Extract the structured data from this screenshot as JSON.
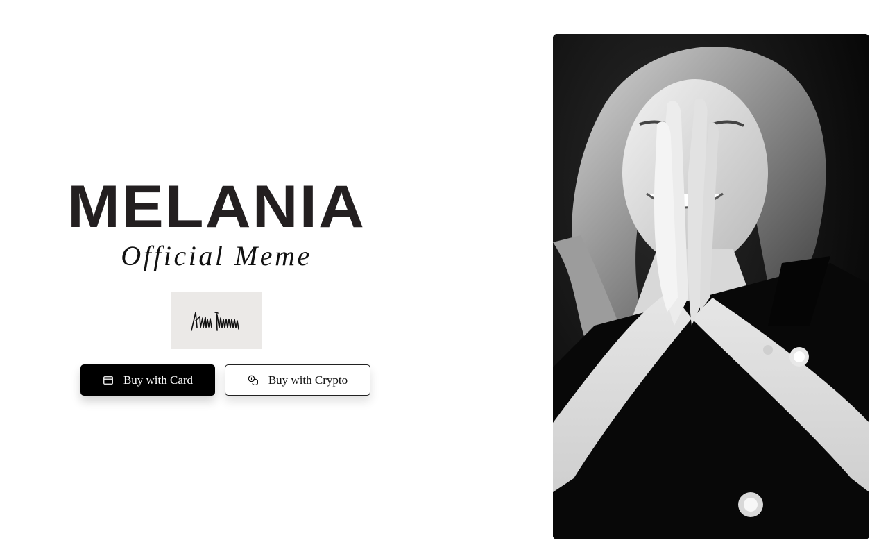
{
  "hero": {
    "title": "MELANIA",
    "subtitle": "Official Meme"
  },
  "signature": {
    "text": "Melania Trump"
  },
  "buttons": {
    "card_label": "Buy with Card",
    "card_icon": "credit-card-icon",
    "crypto_label": "Buy with Crypto",
    "crypto_icon": "coins-icon"
  },
  "portrait": {
    "alt": "Black and white portrait of a smiling woman with hands pressed together"
  },
  "colors": {
    "title": "#231f20",
    "primary_button_bg": "#000000",
    "signature_bg": "#ebe9e7"
  }
}
